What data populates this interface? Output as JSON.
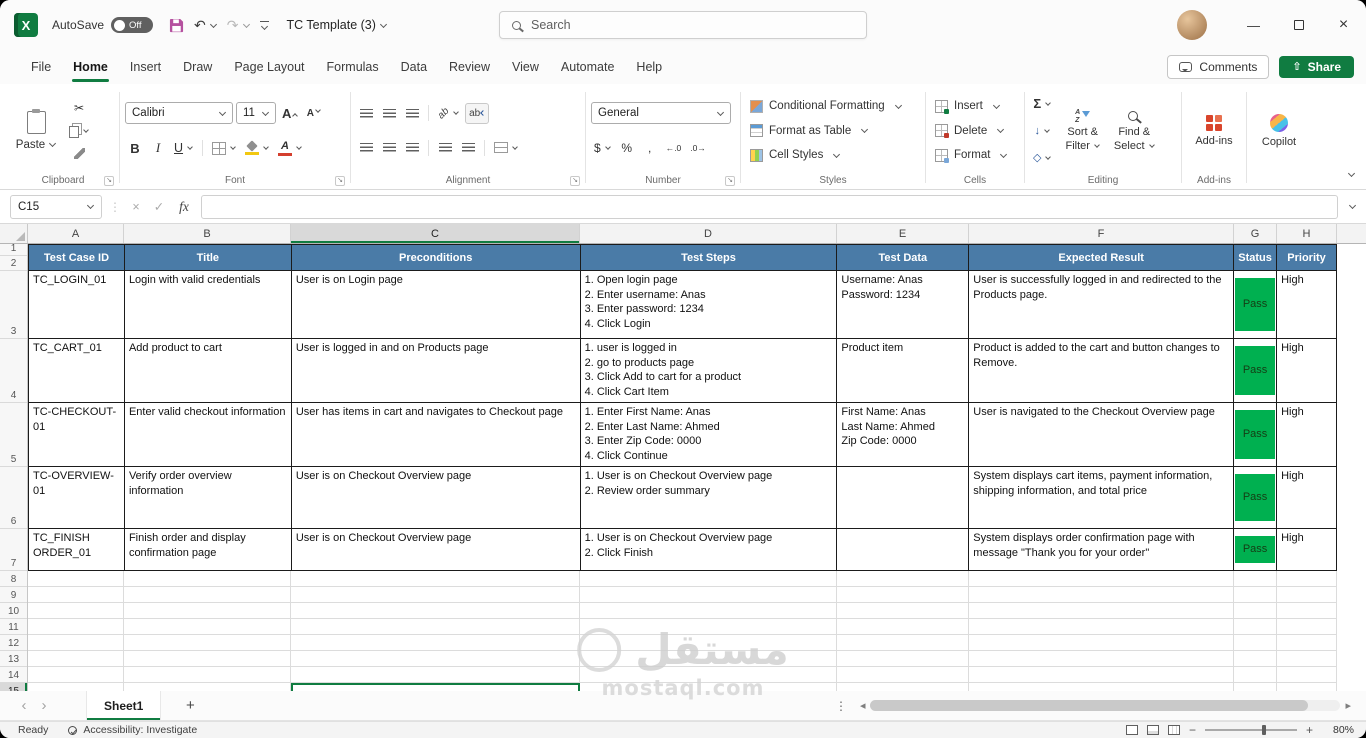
{
  "window": {
    "autosave_label": "AutoSave",
    "autosave_state": "Off",
    "workbook_title": "TC Template (3)",
    "search_placeholder": "Search"
  },
  "menubar": {
    "tabs": [
      "File",
      "Home",
      "Insert",
      "Draw",
      "Page Layout",
      "Formulas",
      "Data",
      "Review",
      "View",
      "Automate",
      "Help"
    ],
    "active_tab": "Home",
    "comments": "Comments",
    "share": "Share"
  },
  "ribbon": {
    "groups": {
      "clipboard": "Clipboard",
      "font": "Font",
      "alignment": "Alignment",
      "number": "Number",
      "styles": "Styles",
      "cells": "Cells",
      "editing": "Editing",
      "addins": "Add-ins"
    },
    "paste": "Paste",
    "font_name": "Calibri",
    "font_size": "11",
    "number_format": "General",
    "conditional_formatting": "Conditional Formatting",
    "format_as_table": "Format as Table",
    "cell_styles": "Cell Styles",
    "insert": "Insert",
    "delete": "Delete",
    "format": "Format",
    "sort_line1": "Sort &",
    "sort_line2": "Filter",
    "find_line1": "Find &",
    "find_line2": "Select",
    "addins_button": "Add-ins",
    "copilot": "Copilot"
  },
  "formula_bar": {
    "name_box": "C15",
    "value": ""
  },
  "grid": {
    "column_headers": [
      "A",
      "B",
      "C",
      "D",
      "E",
      "F",
      "G",
      "H"
    ],
    "row_numbers": [
      "1",
      "2",
      "3",
      "4",
      "5",
      "6",
      "7",
      "8",
      "9",
      "10",
      "11",
      "12",
      "13",
      "14",
      "15"
    ],
    "selected_cell": "C15",
    "selected_column": "C",
    "selected_row": "15"
  },
  "table": {
    "headers": [
      "Test Case ID",
      "Title",
      "Preconditions",
      "Test Steps",
      "Test Data",
      "Expected Result",
      "Status",
      "Priority"
    ],
    "rows": [
      {
        "test_case_id": "TC_LOGIN_01",
        "title": "Login with valid credentials",
        "preconditions": "User is on Login page",
        "test_steps": "1. Open login page\n2. Enter username: Anas\n3. Enter password: 1234\n4. Click Login",
        "test_data": "Username: Anas\nPassword: 1234",
        "expected_result": "User is successfully logged in and redirected to the Products page.",
        "status": "Pass",
        "priority": "High"
      },
      {
        "test_case_id": "TC_CART_01",
        "title": "Add product to cart",
        "preconditions": "User is logged in and on Products page",
        "test_steps": "1. user is logged in\n2. go to products page\n3. Click Add to cart for a product\n4. Click Cart Item",
        "test_data": "Product item",
        "expected_result": "Product is added to the cart and button changes to Remove.",
        "status": "Pass",
        "priority": "High"
      },
      {
        "test_case_id": "TC-CHECKOUT-01",
        "title": "Enter valid checkout information",
        "preconditions": "User has items in cart and navigates to Checkout page",
        "test_steps": "1. Enter First Name: Anas\n2. Enter Last Name: Ahmed\n3. Enter Zip Code: 0000\n4. Click Continue",
        "test_data": "First Name: Anas\nLast Name: Ahmed\nZip Code: 0000",
        "expected_result": "User is navigated to the Checkout Overview page",
        "status": "Pass",
        "priority": "High"
      },
      {
        "test_case_id": "TC-OVERVIEW-01",
        "title": "Verify order overview information",
        "preconditions": "User is on Checkout Overview page",
        "test_steps": "1. User is on Checkout Overview page\n2. Review order summary",
        "test_data": "",
        "expected_result": "System displays cart items, payment information, shipping information, and total price",
        "status": "Pass",
        "priority": "High"
      },
      {
        "test_case_id": "TC_FINISH ORDER_01",
        "title": "Finish order and display confirmation page",
        "preconditions": "User is on Checkout Overview page",
        "test_steps": "1. User is on Checkout Overview page\n2. Click Finish",
        "test_data": "",
        "expected_result": "System displays order confirmation page with message \"Thank you for your order\"",
        "status": "Pass",
        "priority": "High"
      }
    ]
  },
  "sheet_bar": {
    "sheet_name": "Sheet1"
  },
  "status_bar": {
    "ready": "Ready",
    "accessibility": "Accessibility: Investigate",
    "zoom": "80%"
  },
  "watermark": {
    "arabic": "مستقل",
    "domain": "mostaql.com"
  },
  "colors": {
    "table_header_bg": "#4a7ba7",
    "status_pass_bg": "#00b050",
    "accent_green": "#107c41"
  },
  "icons": {
    "excel_logo_letter": "X",
    "scissors": "✂",
    "undo": "↶",
    "redo": "↷",
    "minimize": "—",
    "close": "×",
    "cancel": "×",
    "check": "✓",
    "fx": "fx",
    "bold": "B",
    "italic": "I",
    "underline": "U",
    "font_letter": "A",
    "dollar": "$",
    "percent": "%",
    "comma": ",",
    "increase_decimal": "←.0",
    "decrease_decimal": ".0→",
    "sigma": "Σ",
    "fill_arrow": "↓",
    "clear_diamond": "◇",
    "sort_a": "A",
    "sort_z": "Z",
    "launcher": "↘",
    "dots_vertical": "⋮",
    "plus": "+",
    "nav_left": "‹",
    "nav_right": "›",
    "scroll_left": "◂",
    "scroll_right": "▸",
    "minus": "−",
    "orientation_text": "ab",
    "wrap_text": "ab",
    "share_arrow": "⇧"
  }
}
